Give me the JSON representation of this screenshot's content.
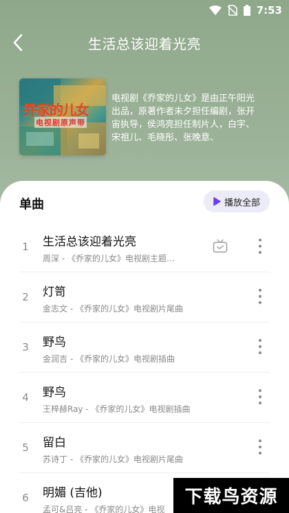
{
  "status_bar": {
    "time": "7:53"
  },
  "header": {
    "title": "生活总该迎着光亮"
  },
  "album": {
    "cover_title": "乔家的儿女",
    "cover_subtitle": "电视剧原声带",
    "description": "电视剧《乔家的儿女》是由正午阳光出品，原著作者未夕担任编剧，张开宙执导，侯鸿亮担任制片人，白宇、宋祖儿、毛晓彤、张晚意、"
  },
  "section": {
    "title": "单曲",
    "play_all_label": "播放全部"
  },
  "tracks": [
    {
      "num": "1",
      "title": "生活总该迎着光亮",
      "subtitle": "周深 - 《乔家的儿女》电视剧主题…",
      "has_mv": true
    },
    {
      "num": "2",
      "title": "灯笥",
      "subtitle": "金志文 - 《乔家的儿女》电视剧片尾曲",
      "has_mv": false
    },
    {
      "num": "3",
      "title": "野鸟",
      "subtitle": "金润吉 - 《乔家的儿女》电视剧插曲",
      "has_mv": false
    },
    {
      "num": "4",
      "title": "野鸟",
      "subtitle": "王梓赫Ray - 《乔家的儿女》电视剧插曲",
      "has_mv": false
    },
    {
      "num": "5",
      "title": "留白",
      "subtitle": "苏诗丁 - 《乔家的儿女》电视剧片尾曲",
      "has_mv": false
    },
    {
      "num": "6",
      "title": "明媚 (吉他)",
      "subtitle": "孟可&吕亮 - 《乔家的儿女》电视",
      "has_mv": false
    }
  ],
  "watermark": {
    "text": "下载鸟资源"
  },
  "colors": {
    "accent": "#6a3df0",
    "play_all_bg": "#ecebf8"
  }
}
